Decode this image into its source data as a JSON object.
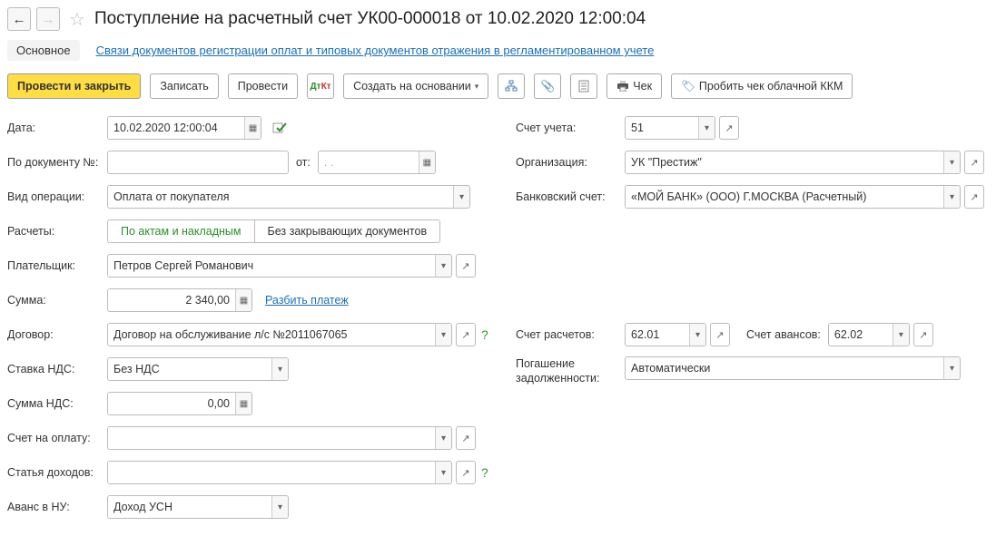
{
  "header": {
    "title": "Поступление на расчетный счет УК00-000018 от 10.02.2020 12:00:04"
  },
  "tabs": {
    "main": "Основное",
    "link": "Связи документов регистрации оплат и типовых документов отражения в регламентированном учете"
  },
  "toolbar": {
    "post_close": "Провести и закрыть",
    "save": "Записать",
    "post": "Провести",
    "create_based": "Создать на основании",
    "cheque": "Чек",
    "cloud_kkm": "Пробить чек облачной ККМ"
  },
  "left": {
    "date_label": "Дата:",
    "date_value": "10.02.2020 12:00:04",
    "docnum_label": "По документу №:",
    "docnum_from": "от:",
    "docnum_placeholder": ".   .",
    "optype_label": "Вид операции:",
    "optype_value": "Оплата от покупателя",
    "settle_label": "Расчеты:",
    "seg1": "По актам и накладным",
    "seg2": "Без закрывающих документов",
    "payer_label": "Плательщик:",
    "payer_value": "Петров Сергей Романович",
    "sum_label": "Сумма:",
    "sum_value": "2 340,00",
    "split_link": "Разбить платеж",
    "contract_label": "Договор:",
    "contract_value": "Договор на обслуживание л/с №2011067065",
    "vat_rate_label": "Ставка НДС:",
    "vat_rate_value": "Без НДС",
    "vat_sum_label": "Сумма НДС:",
    "vat_sum_value": "0,00",
    "invoice_label": "Счет на оплату:",
    "income_label": "Статья доходов:",
    "advance_label": "Аванс в НУ:",
    "advance_value": "Доход УСН"
  },
  "right": {
    "account_label": "Счет учета:",
    "account_value": "51",
    "org_label": "Организация:",
    "org_value": "УК \"Престиж\"",
    "bank_label": "Банковский счет:",
    "bank_value": "«МОЙ БАНК» (ООО) Г.МОСКВА (Расчетный)",
    "settle_acc_label": "Счет расчетов:",
    "settle_acc_value": "62.01",
    "adv_acc_label": "Счет авансов:",
    "adv_acc_value": "62.02",
    "debt_label": "Погашение задолженности:",
    "debt_value": "Автоматически"
  }
}
